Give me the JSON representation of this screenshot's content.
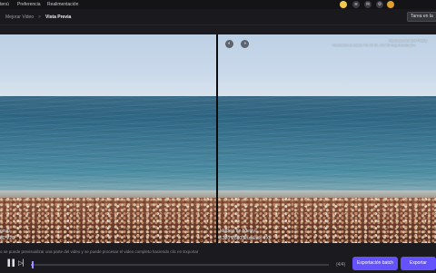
{
  "menubar": {
    "items": [
      "tenú",
      "Preferencia",
      "Realimentación"
    ]
  },
  "tray_icons": [
    "user-avatar-icon",
    "wifi-icon",
    "mail-icon",
    "settings-icon",
    "avatar-badge-icon"
  ],
  "breadcrumb": {
    "root": "Mejorar Video",
    "separator": ">",
    "current": "Vista Previa"
  },
  "queue_button": "Tarea en la",
  "preview": {
    "left_label_line1": "ginal",
    "left_label_line2": "80*720",
    "right_label_line1": "Modelo de fidelity",
    "right_label_line2": "5120*2880(Escalado 4X)",
    "right_meta_line1": "Resolución 5K 16:9 Fidelity",
    "right_meta_line2": "Resolución de salida: 4K, 5K 4X, 10K 5K SuperResolución"
  },
  "hint_text": "o se puede previsualizar una parte del video y se puede procesar el video completo haciendo clic en Exportar",
  "controls": {
    "play_icon": "▐▐",
    "next_icon": "▷▏",
    "time": "(4/4)",
    "progress": 0.005,
    "batch_label": "Exportación batch",
    "export_label": "Exportar"
  },
  "colors": {
    "accent": "#6552ff",
    "background": "#1b1b1f"
  }
}
